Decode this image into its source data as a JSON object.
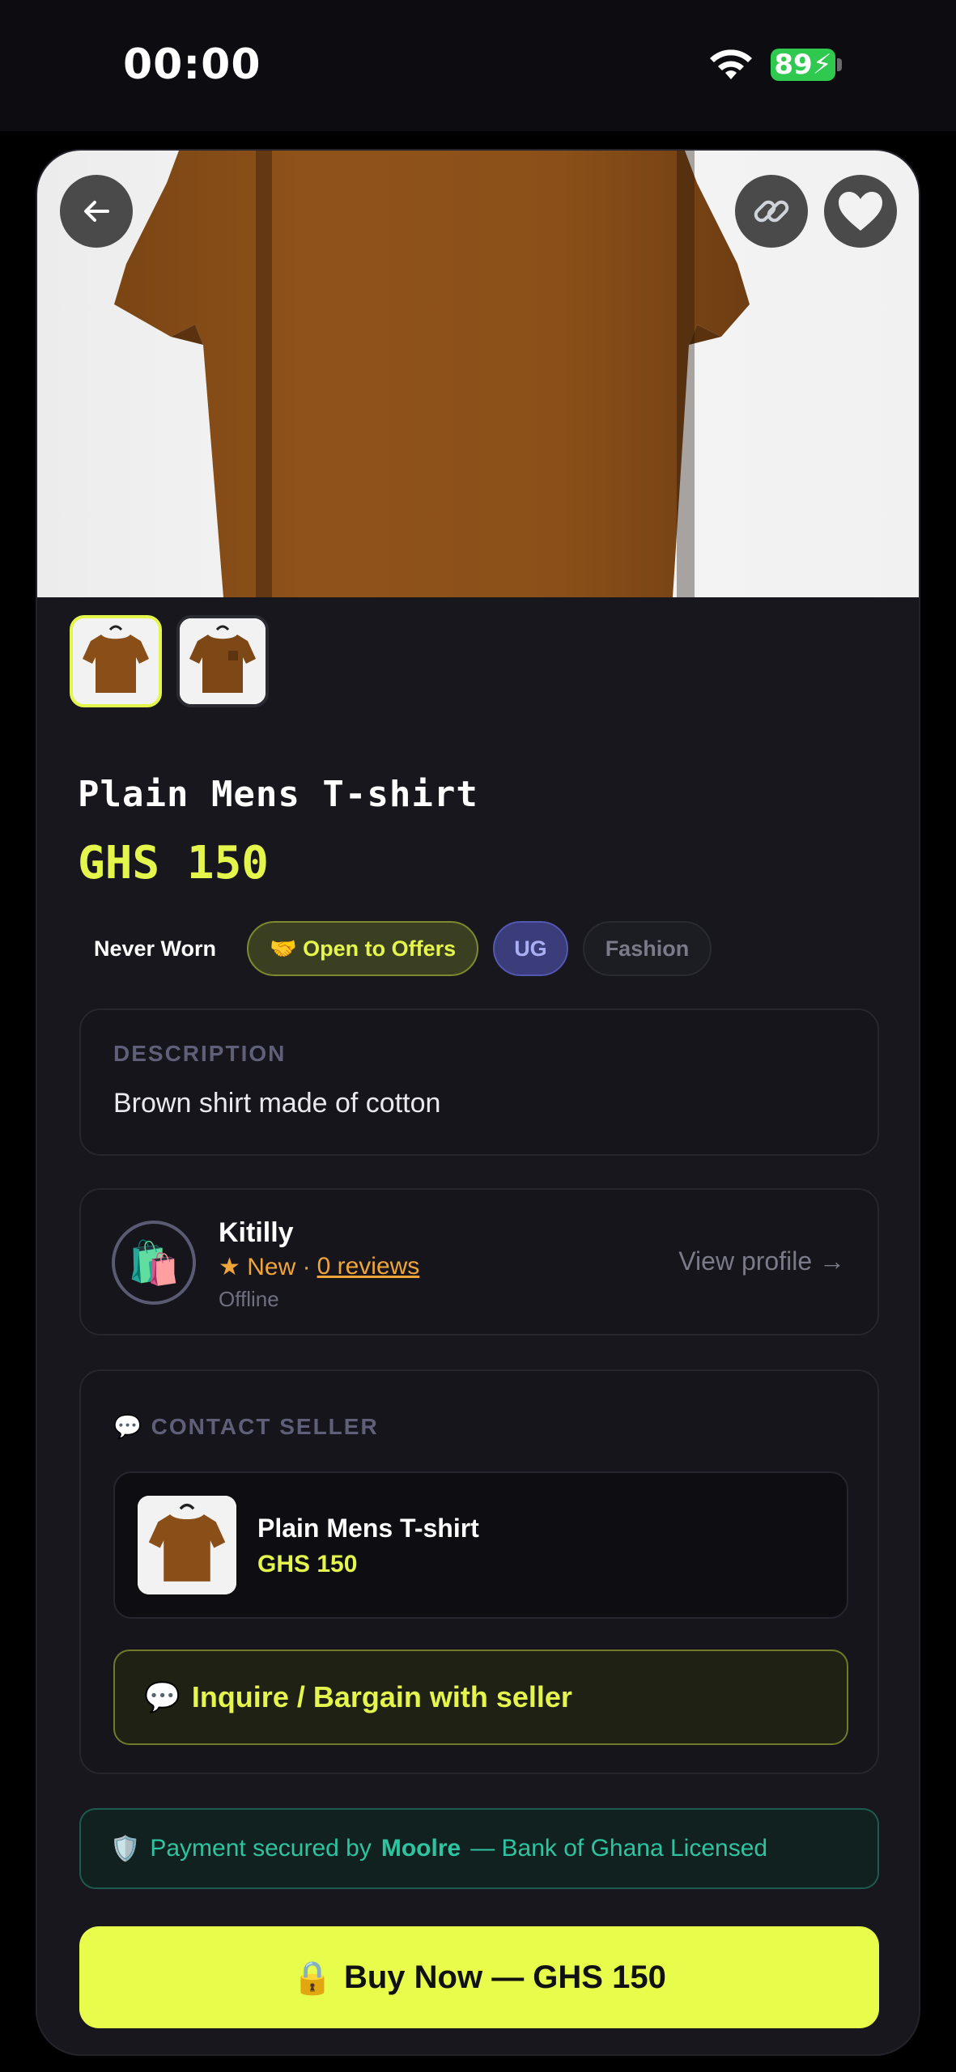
{
  "status_bar": {
    "time": "00:00",
    "battery": "89"
  },
  "product": {
    "title": "Plain Mens T-shirt",
    "price": "GHS 150",
    "tags": {
      "condition": "Never Worn",
      "offers": "🤝 Open to Offers",
      "region": "UG",
      "category": "Fashion"
    }
  },
  "description": {
    "label": "DESCRIPTION",
    "text": "Brown shirt made of cotton"
  },
  "seller": {
    "avatar_emoji": "🛍️",
    "name": "Kitilly",
    "rating": "★ New ·",
    "reviews": "0 reviews",
    "status": "Offline",
    "view_profile": "View profile →"
  },
  "contact": {
    "label": "💬 CONTACT SELLER",
    "item_title": "Plain Mens T-shirt",
    "item_price": "GHS 150",
    "inquire_label": "Inquire / Bargain with seller",
    "inquire_icon": "💬"
  },
  "security": {
    "icon": "🛡️",
    "prefix": "Payment secured by",
    "brand": "Moolre",
    "suffix": "— Bank of Ghana Licensed"
  },
  "buy": {
    "icon": "🔒",
    "label": "Buy Now — GHS 150"
  },
  "colors": {
    "accent": "#e4f54b",
    "background": "#17171d",
    "secure": "#2ec4a0",
    "rating": "#f0a53a"
  }
}
